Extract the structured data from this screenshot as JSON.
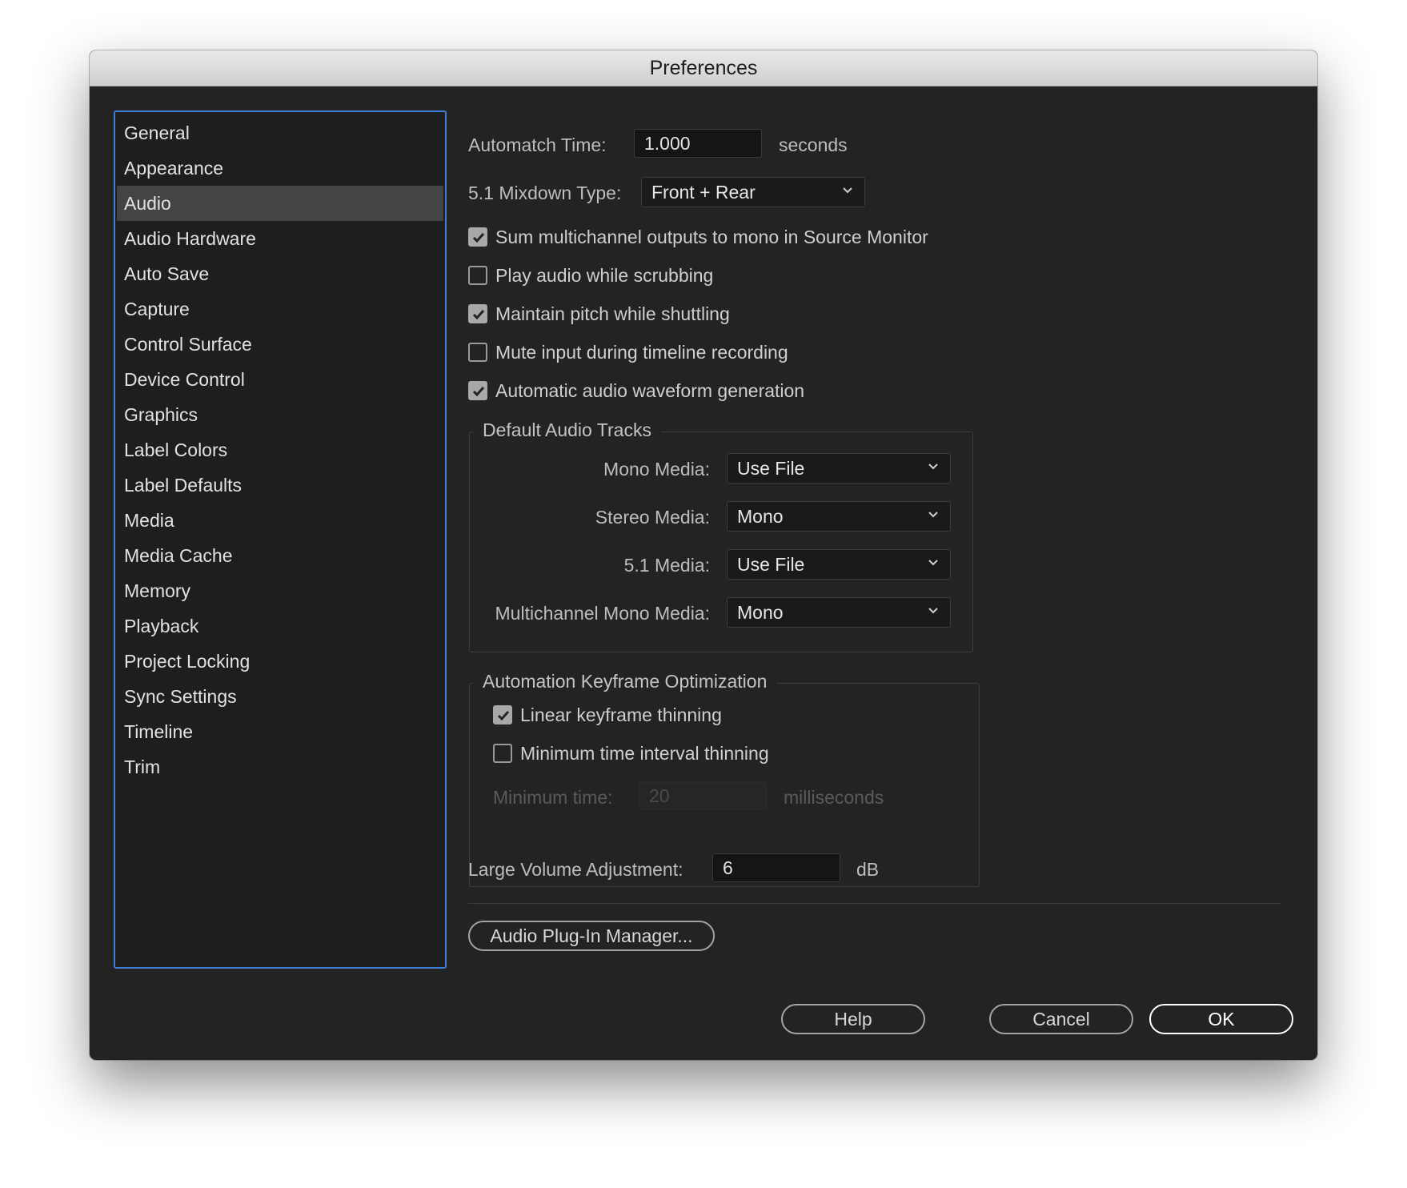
{
  "window": {
    "title": "Preferences"
  },
  "sidebar": {
    "items": [
      {
        "label": "General"
      },
      {
        "label": "Appearance"
      },
      {
        "label": "Audio",
        "selected": true
      },
      {
        "label": "Audio Hardware"
      },
      {
        "label": "Auto Save"
      },
      {
        "label": "Capture"
      },
      {
        "label": "Control Surface"
      },
      {
        "label": "Device Control"
      },
      {
        "label": "Graphics"
      },
      {
        "label": "Label Colors"
      },
      {
        "label": "Label Defaults"
      },
      {
        "label": "Media"
      },
      {
        "label": "Media Cache"
      },
      {
        "label": "Memory"
      },
      {
        "label": "Playback"
      },
      {
        "label": "Project Locking"
      },
      {
        "label": "Sync Settings"
      },
      {
        "label": "Timeline"
      },
      {
        "label": "Trim"
      }
    ]
  },
  "audio": {
    "automatch": {
      "label": "Automatch Time:",
      "value": "1.000",
      "unit": "seconds"
    },
    "mixdown": {
      "label": "5.1 Mixdown Type:",
      "value": "Front + Rear"
    },
    "checkboxes": [
      {
        "label": "Sum multichannel outputs to mono in Source Monitor",
        "checked": true
      },
      {
        "label": "Play audio while scrubbing",
        "checked": false
      },
      {
        "label": "Maintain pitch while shuttling",
        "checked": true
      },
      {
        "label": "Mute input during timeline recording",
        "checked": false
      },
      {
        "label": "Automatic audio waveform generation",
        "checked": true
      }
    ],
    "default_tracks": {
      "title": "Default Audio Tracks",
      "mono": {
        "label": "Mono Media:",
        "value": "Use File"
      },
      "stereo": {
        "label": "Stereo Media:",
        "value": "Mono"
      },
      "five_one": {
        "label": "5.1 Media:",
        "value": "Use File"
      },
      "multichannel": {
        "label": "Multichannel Mono Media:",
        "value": "Mono"
      }
    },
    "keyframe": {
      "title": "Automation Keyframe Optimization",
      "linear": {
        "label": "Linear keyframe thinning",
        "checked": true
      },
      "min_interval": {
        "label": "Minimum time interval thinning",
        "checked": false
      },
      "min_time": {
        "label": "Minimum time:",
        "value": "20",
        "unit": "milliseconds"
      }
    },
    "large_volume": {
      "label": "Large Volume Adjustment:",
      "value": "6",
      "unit": "dB"
    },
    "plugin_manager": "Audio Plug-In Manager..."
  },
  "footer": {
    "help": "Help",
    "cancel": "Cancel",
    "ok": "OK"
  },
  "colors": {
    "window_bg": "#232323",
    "sidebar_focus": "#3d7fd6",
    "selected_item": "#444444"
  }
}
